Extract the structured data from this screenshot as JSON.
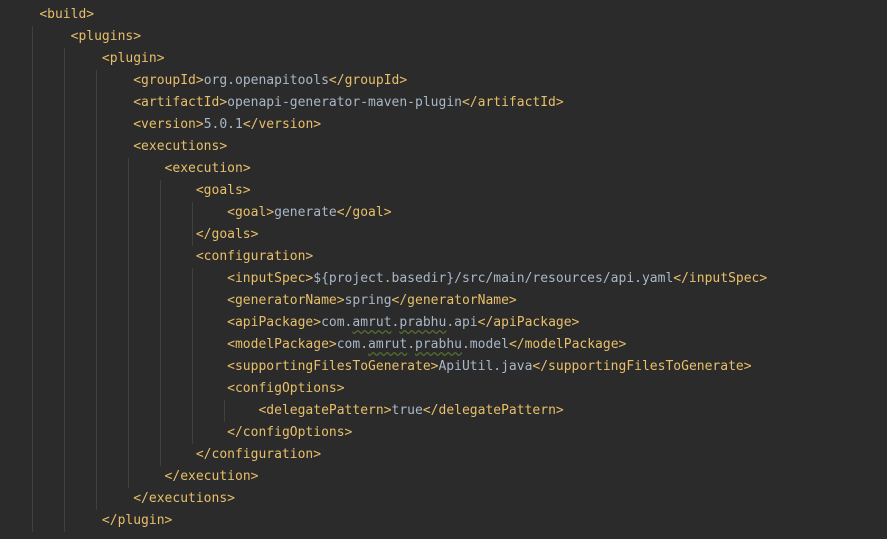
{
  "xml": {
    "build": {
      "open": "<build>",
      "plugins": {
        "open": "<plugins>",
        "plugin": {
          "open": "<plugin>",
          "groupId": {
            "open": "<groupId>",
            "value": "org.openapitools",
            "close": "</groupId>"
          },
          "artifactId": {
            "open": "<artifactId>",
            "value": "openapi-generator-maven-plugin",
            "close": "</artifactId>"
          },
          "version": {
            "open": "<version>",
            "value": "5.0.1",
            "close": "</version>"
          },
          "executions": {
            "open": "<executions>",
            "execution": {
              "open": "<execution>",
              "goals": {
                "open": "<goals>",
                "goal": {
                  "open": "<goal>",
                  "value": "generate",
                  "close": "</goal>"
                },
                "close": "</goals>"
              },
              "configuration": {
                "open": "<configuration>",
                "inputSpec": {
                  "open": "<inputSpec>",
                  "value": "${project.basedir}/src/main/resources/api.yaml",
                  "close": "</inputSpec>"
                },
                "generatorName": {
                  "open": "<generatorName>",
                  "value": "spring",
                  "close": "</generatorName>"
                },
                "apiPackage": {
                  "open": "<apiPackage>",
                  "value_prefix": "com.",
                  "value_u1": "amrut",
                  "value_dot1": ".",
                  "value_u2": "prabhu",
                  "value_suffix": ".api",
                  "close": "</apiPackage>"
                },
                "modelPackage": {
                  "open": "<modelPackage>",
                  "value_prefix": "com.",
                  "value_u1": "amrut",
                  "value_dot1": ".",
                  "value_u2": "prabhu",
                  "value_suffix": ".model",
                  "close": "</modelPackage>"
                },
                "supportingFiles": {
                  "open": "<supportingFilesToGenerate>",
                  "value": "ApiUtil.java",
                  "close": "</supportingFilesToGenerate>"
                },
                "configOptions": {
                  "open": "<configOptions>",
                  "delegatePattern": {
                    "open": "<delegatePattern>",
                    "value": "true",
                    "close": "</delegatePattern>"
                  },
                  "close": "</configOptions>"
                },
                "close": "</configuration>"
              },
              "close": "</execution>"
            },
            "close": "</executions>"
          },
          "close": "</plugin>"
        }
      }
    }
  },
  "indents": {
    "i1": "    ",
    "i2": "        ",
    "i3": "            ",
    "i4": "                ",
    "i5": "                    ",
    "i6": "                        ",
    "i7": "                            "
  }
}
